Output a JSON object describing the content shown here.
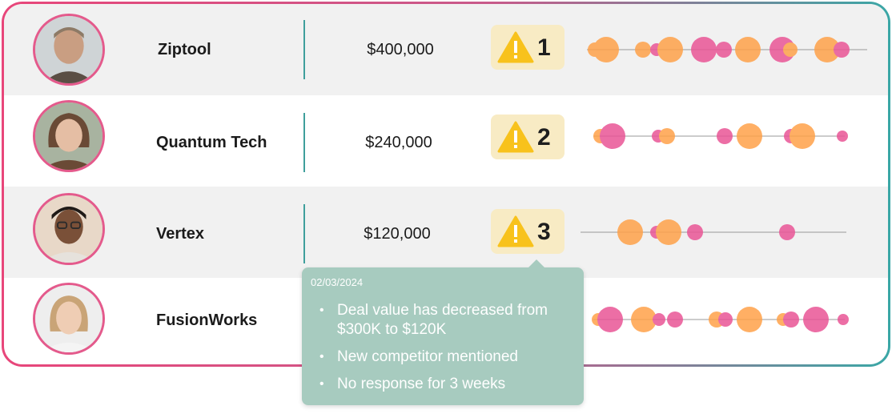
{
  "colors": {
    "accent_pink": "#e8467a",
    "accent_teal": "#3aa7a6",
    "bubble_orange": "#ffa24a",
    "bubble_pink": "#e95596",
    "warning": "#f8c21c"
  },
  "deals": [
    {
      "name": "Ziptool",
      "value": "$400,000",
      "risk_rank": "1",
      "icon": "warning-icon"
    },
    {
      "name": "Quantum Tech",
      "value": "$240,000",
      "risk_rank": "2",
      "icon": "warning-icon"
    },
    {
      "name": "Vertex",
      "value": "$120,000",
      "risk_rank": "3",
      "icon": "warning-icon"
    },
    {
      "name": "FusionWorks",
      "value": "",
      "risk_rank": "",
      "icon": ""
    }
  ],
  "tooltip": {
    "date": "02/03/2024",
    "items": [
      "Deal value has decreased from $300K to $120K",
      "New competitor mentioned",
      "No response for 3 weeks"
    ]
  }
}
